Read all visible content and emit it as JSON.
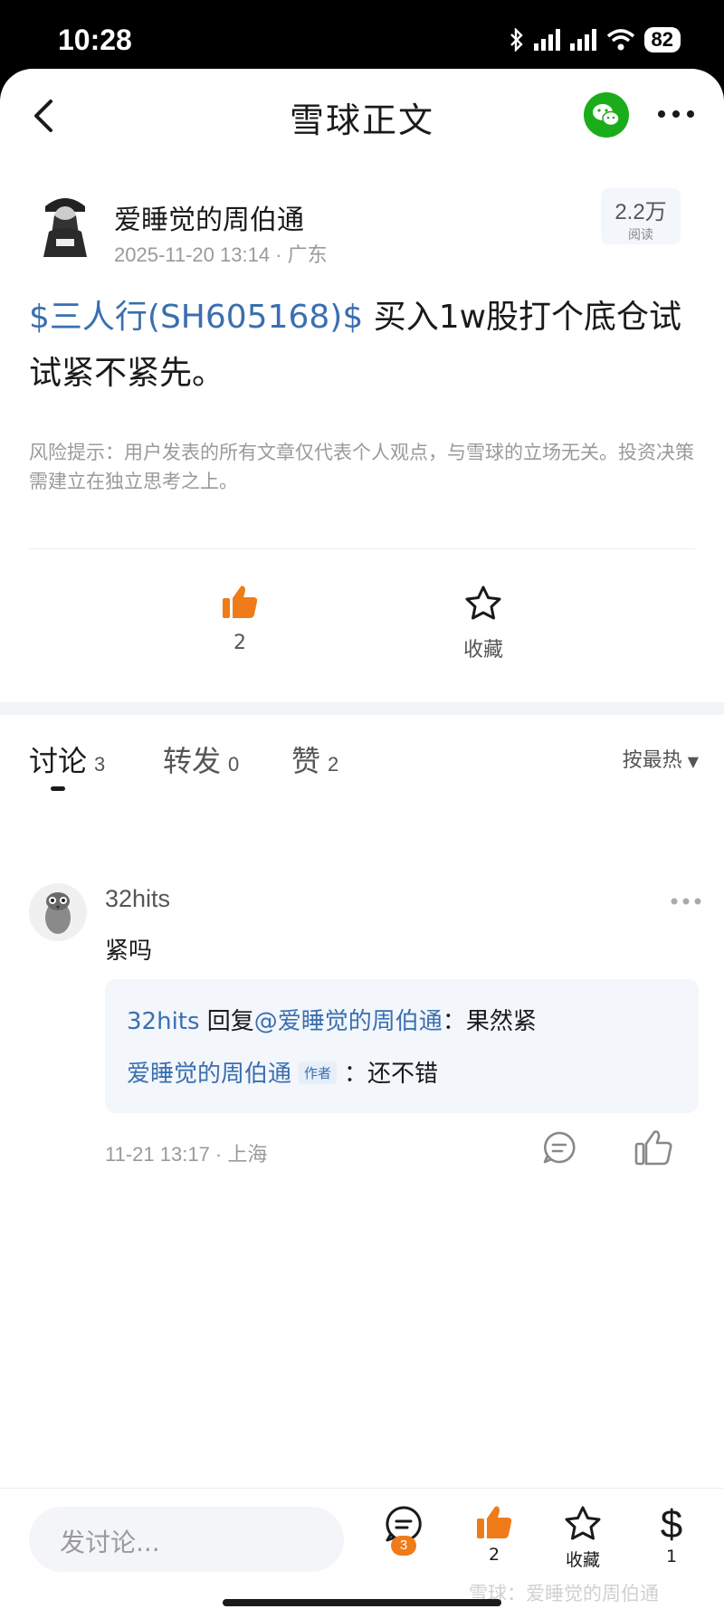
{
  "status_bar": {
    "time": "10:28",
    "battery": "82"
  },
  "nav": {
    "title": "雪球正文"
  },
  "author": {
    "name": "爱睡觉的周伯通",
    "meta": "2025-11-20 13:14 · 广东",
    "reads_count": "2.2万",
    "reads_label": "阅读"
  },
  "post": {
    "stock": "$三人行(SH605168)$",
    "text": " 买入1w股打个底仓试试紧不紧先。",
    "risk": "风险提示：用户发表的所有文章仅代表个人观点，与雪球的立场无关。投资决策需建立在独立思考之上。"
  },
  "actions": {
    "like_count": "2",
    "favorite_label": "收藏"
  },
  "tabs": [
    {
      "label": "讨论",
      "count": "3"
    },
    {
      "label": "转发",
      "count": "0"
    },
    {
      "label": "赞",
      "count": "2"
    }
  ],
  "sort": {
    "label": "按最热"
  },
  "comment": {
    "user": "32hits",
    "text": "紧吗",
    "replies": [
      {
        "user": "32hits",
        "verb": " 回复",
        "target": "@爱睡觉的周伯通",
        "text": "：果然紧"
      },
      {
        "user": "爱睡觉的周伯通",
        "tag": "作者",
        "text": "：还不错"
      }
    ],
    "meta": "11-21 13:17 · 上海"
  },
  "bottom_bar": {
    "placeholder": "发讨论...",
    "discuss_badge": "3",
    "like_count": "2",
    "favorite_label": "收藏",
    "reward_symbol": "$",
    "reward_count": "1",
    "watermark": "雪球：爱睡觉的周伯通"
  },
  "colors": {
    "accent_blue": "#3a6fb0",
    "like_orange": "#f07b19",
    "wechat_green": "#1aad19"
  }
}
